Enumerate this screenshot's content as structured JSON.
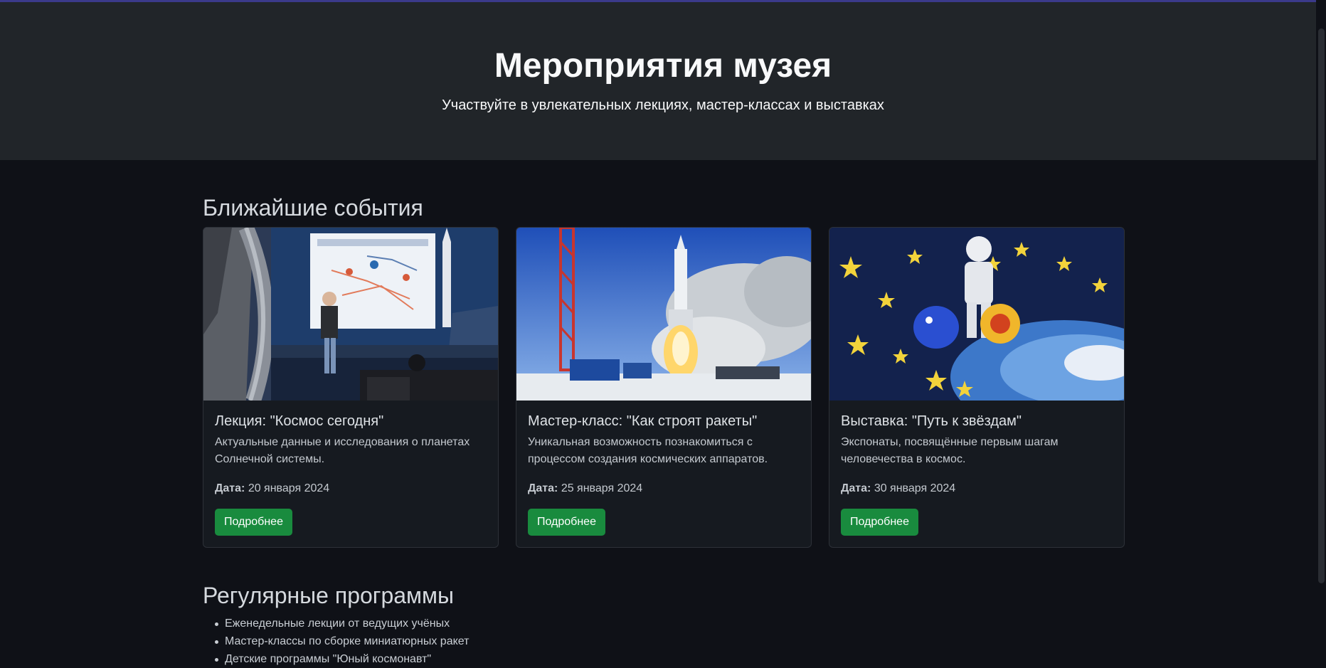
{
  "hero": {
    "title": "Мероприятия музея",
    "subtitle": "Участвуйте в увлекательных лекциях, мастер-классах и выставках"
  },
  "upcoming": {
    "heading": "Ближайшие события",
    "cards": [
      {
        "image": "lecture-photo",
        "title": "Лекция: \"Космос сегодня\"",
        "text": "Актуальные данные и исследования о планетах Солнечной системы.",
        "date_label": "Дата:",
        "date": "20 января 2024",
        "button": "Подробнее"
      },
      {
        "image": "rocket-launch-photo",
        "title": "Мастер-класс: \"Как строят ракеты\"",
        "text": "Уникальная возможность познакомиться с процессом создания космических аппаратов.",
        "date_label": "Дата:",
        "date": "25 января 2024",
        "button": "Подробнее"
      },
      {
        "image": "stars-painting-photo",
        "title": "Выставка: \"Путь к звёздам\"",
        "text": "Экспонаты, посвящённые первым шагам человечества в космос.",
        "date_label": "Дата:",
        "date": "30 января 2024",
        "button": "Подробнее"
      }
    ]
  },
  "regular": {
    "heading": "Регулярные программы",
    "items": [
      "Еженедельные лекции от ведущих учёных",
      "Мастер-классы по сборке миниатюрных ракет",
      "Детские программы \"Юный космонавт\""
    ]
  },
  "colors": {
    "background": "#0f1117",
    "hero_background": "#212529",
    "card_background": "#161a20",
    "button": "#198b3e"
  }
}
